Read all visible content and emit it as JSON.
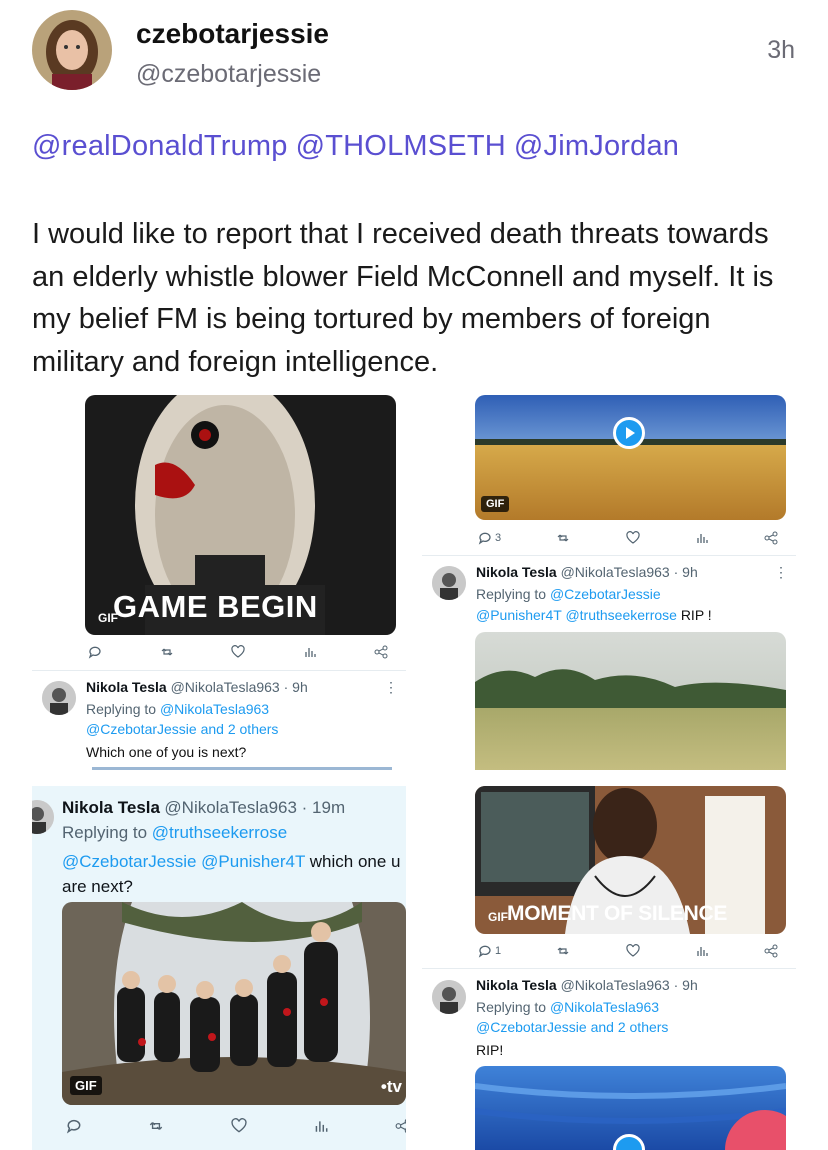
{
  "post": {
    "display_name": "czebotarjessie",
    "handle": "@czebotarjessie",
    "time": "3h",
    "mentions": [
      "@realDonaldTrump",
      "@THOLMSETH",
      "@JimJordan"
    ],
    "text": "I would like to report that I received death threats towards an elderly whistle blower Field McConnell and myself. It is my belief FM is being tortured by members of foreign military and foreign intelligence."
  },
  "screens": {
    "top_left": {
      "gif_label": "GIF",
      "caption": "GAME BEGIN"
    },
    "top_right": {
      "gif_label": "GIF",
      "reply_count": "3"
    },
    "mid_left_tweet": {
      "name": "Nikola Tesla",
      "meta": "@NikolaTesla963 · 9h",
      "replying_prefix": "Replying to",
      "replying_handles": "@NikolaTesla963",
      "replying_line2": "@CzebotarJessie and 2 others",
      "text": "Which one of you is next?"
    },
    "mid_right_tweet": {
      "name": "Nikola Tesla",
      "meta": "@NikolaTesla963 · 9h",
      "replying_prefix": "Replying to",
      "replying_handles": "@CzebotarJessie",
      "replying_line2": "@Punisher4T @truthseekerrose",
      "text": "RIP !"
    },
    "bottom_left_tweet": {
      "name": "Nikola Tesla",
      "meta": "@NikolaTesla963 · 19m",
      "replying_prefix": "Replying to",
      "replying_handles": "@truthseekerrose",
      "replying_line2": "@CzebotarJessie @Punisher4T",
      "text": "which one u are next?",
      "gif_label": "GIF",
      "watermark": "•tv"
    },
    "right_gif2": {
      "gif_label": "GIF",
      "caption": "MOMENT OF SILENCE",
      "reply_count": "1"
    },
    "bottom_right_tweet": {
      "name": "Nikola Tesla",
      "meta": "@NikolaTesla963 · 9h",
      "replying_prefix": "Replying to",
      "replying_handles": "@NikolaTesla963",
      "replying_line2": "@CzebotarJessie and 2 others",
      "text": "RIP!"
    }
  },
  "icons": [
    "reply-icon",
    "retweet-icon",
    "like-icon",
    "views-icon",
    "share-icon",
    "play-icon"
  ],
  "colors": {
    "mention": "#5a4fd1",
    "link": "#1d9bf0",
    "muted": "#6b6b75"
  }
}
